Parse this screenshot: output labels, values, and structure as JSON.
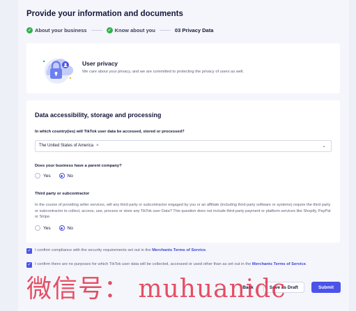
{
  "header": {
    "title": "Provide your information and documents"
  },
  "steps": [
    {
      "label": "About your business",
      "state": "done"
    },
    {
      "label": "Know about you",
      "state": "done"
    },
    {
      "label": "03 Privacy Data",
      "state": "current"
    }
  ],
  "privacy_card": {
    "title": "User privacy",
    "description": "We care about your privacy, and we are committed to protecting the privacy of users as well."
  },
  "data_section": {
    "title": "Data accessibility, storage and processing",
    "country_question": "In which country(ies) will TikTok user data be accessed, stored or processed?",
    "country_selected": "The United States of America",
    "parent_question": "Does your business have a parent company?",
    "parent_yes": "Yes",
    "parent_no": "No",
    "parent_selected": "No",
    "third_party_title": "Third party or subcontractor",
    "third_party_text": "In the course of providing seller services, will any third party or subcontractor engaged by you or an affiliate (including third party software or systems) require the third party or subcontractor to collect, access, use, process or store any TikTok user Data? This question does not include third-party payment or platform services like Shopify, PayPal or Stripe.",
    "third_yes": "Yes",
    "third_no": "No",
    "third_selected": "No"
  },
  "consents": [
    {
      "text": "I confirm compliance with the security requirements set out in the ",
      "link": "Merchants Terms of Service",
      "suffix": ".",
      "checked": true
    },
    {
      "text": "I confirm there are no purposes for which TikTok user data will be collected, accessed or used other than as set out in the ",
      "link": "Merchants Terms of Service",
      "suffix": ".",
      "checked": true
    }
  ],
  "footer": {
    "back": "Back",
    "save_draft": "Save as Draft",
    "submit": "Submit"
  },
  "watermark": "微信号： muhuanidc",
  "colors": {
    "accent": "#4b53e8",
    "success": "#2fb34a",
    "watermark": "#e0203a"
  }
}
